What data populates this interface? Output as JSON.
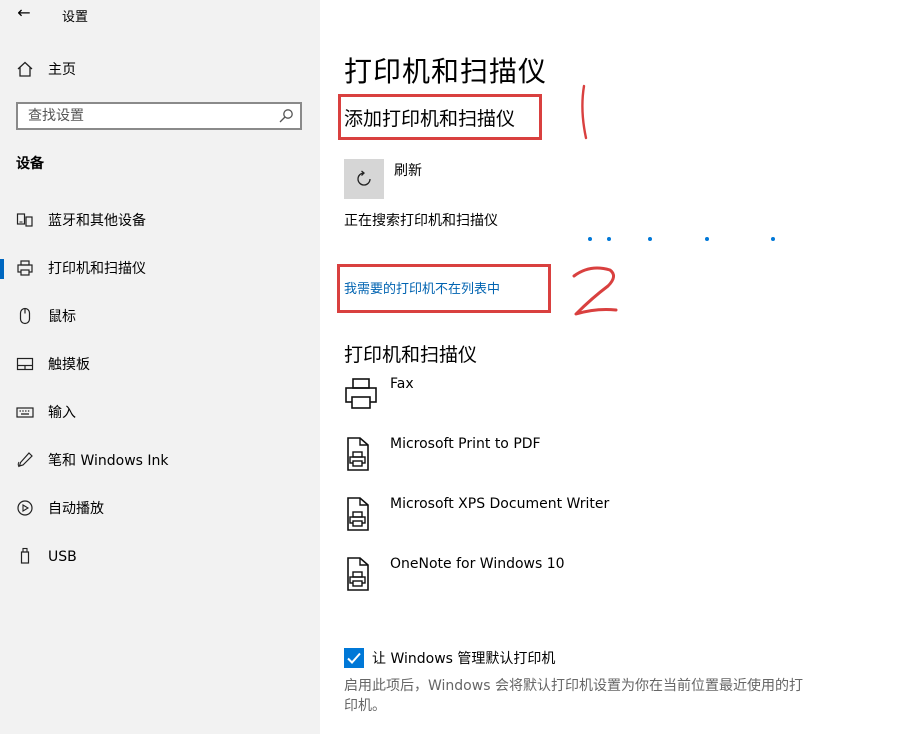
{
  "window": {
    "back_label": "←",
    "title": "设置"
  },
  "sidebar": {
    "home_label": "主页",
    "search_placeholder": "查找设置",
    "section_title": "设备",
    "items": [
      {
        "label": "蓝牙和其他设备",
        "icon": "bluetooth-devices-icon"
      },
      {
        "label": "打印机和扫描仪",
        "icon": "printer-icon",
        "active": true
      },
      {
        "label": "鼠标",
        "icon": "mouse-icon"
      },
      {
        "label": "触摸板",
        "icon": "touchpad-icon"
      },
      {
        "label": "输入",
        "icon": "keyboard-icon"
      },
      {
        "label": "笔和 Windows Ink",
        "icon": "pen-icon"
      },
      {
        "label": "自动播放",
        "icon": "autoplay-icon"
      },
      {
        "label": "USB",
        "icon": "usb-icon"
      }
    ]
  },
  "main": {
    "title": "打印机和扫描仪",
    "add_label": "添加打印机和扫描仪",
    "refresh_label": "刷新",
    "searching_text": "正在搜索打印机和扫描仪",
    "not_listed_link": "我需要的打印机不在列表中",
    "list_title": "打印机和扫描仪",
    "printers": [
      {
        "name": "Fax",
        "icon": "fax-printer-icon"
      },
      {
        "name": "Microsoft Print to PDF",
        "icon": "document-printer-icon"
      },
      {
        "name": "Microsoft XPS Document Writer",
        "icon": "document-printer-icon"
      },
      {
        "name": "OneNote for Windows 10",
        "icon": "document-printer-icon"
      }
    ],
    "manage_default": {
      "checked": true,
      "label": "让 Windows 管理默认打印机",
      "description": "启用此项后，Windows 会将默认打印机设置为你在当前位置最近使用的打印机。"
    }
  },
  "colors": {
    "accent": "#0078d7",
    "link": "#0063b1",
    "annotation": "#d9403f",
    "sidebar_bg": "#f2f2f2"
  }
}
